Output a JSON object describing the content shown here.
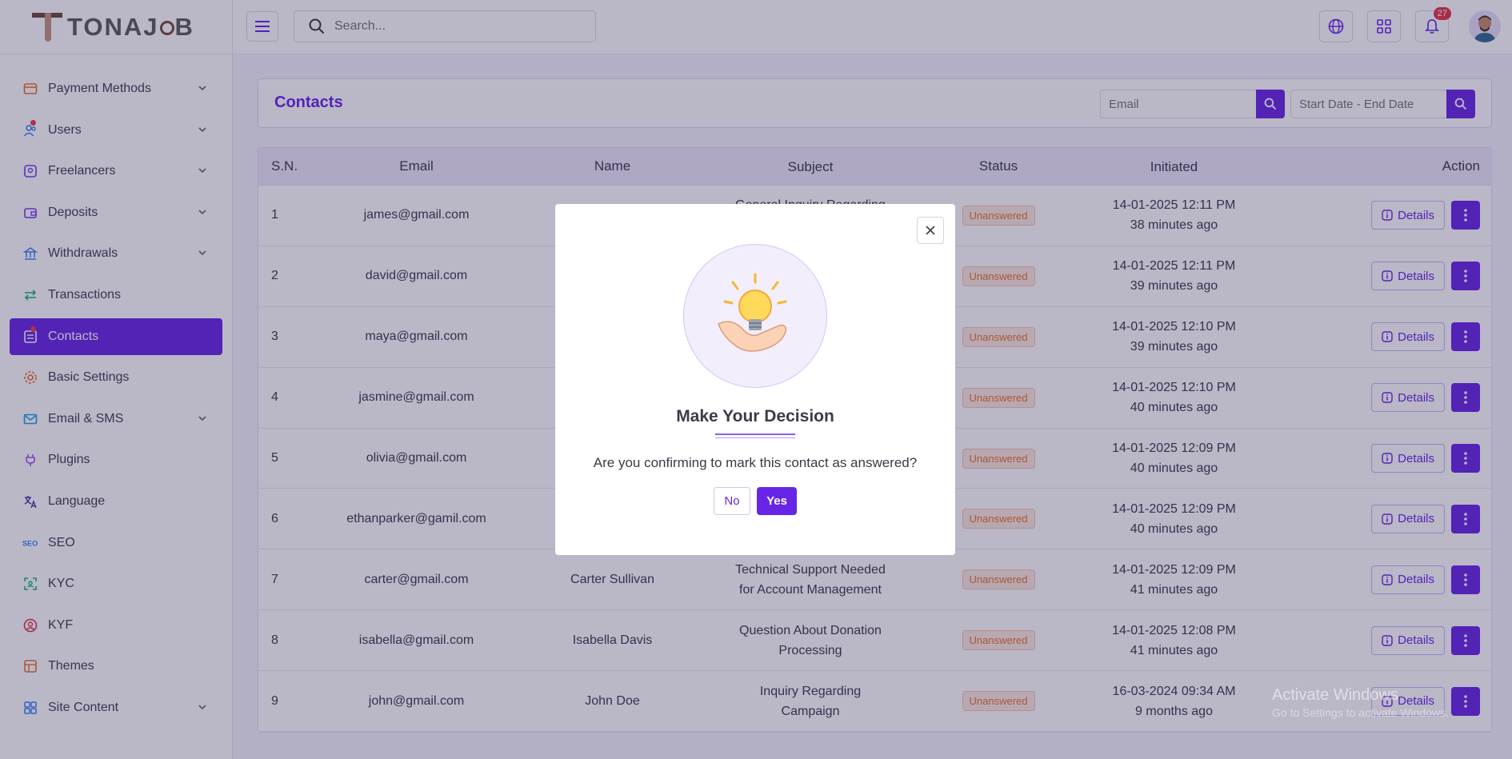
{
  "brand": {
    "logo_text": "TONAJ",
    "logo_text2": "B"
  },
  "header": {
    "search_placeholder": "Search...",
    "notifications_count": "27",
    "icons": [
      "menu-icon",
      "search-icon",
      "globe-icon",
      "apps-grid-icon",
      "bell-icon"
    ]
  },
  "sidebar": {
    "items": [
      {
        "label": "Payment Methods",
        "icon": "payment-icon",
        "has_chevron": true
      },
      {
        "label": "Users",
        "icon": "users-icon",
        "has_chevron": true,
        "dot": true
      },
      {
        "label": "Freelancers",
        "icon": "freelancer-icon",
        "has_chevron": true
      },
      {
        "label": "Deposits",
        "icon": "wallet-icon",
        "has_chevron": true
      },
      {
        "label": "Withdrawals",
        "icon": "bank-icon",
        "has_chevron": true
      },
      {
        "label": "Transactions",
        "icon": "transfer-icon",
        "has_chevron": false
      },
      {
        "label": "Contacts",
        "icon": "contacts-icon",
        "has_chevron": false,
        "active": true,
        "dot": true
      },
      {
        "label": "Basic Settings",
        "icon": "gear-icon",
        "has_chevron": false
      },
      {
        "label": "Email & SMS",
        "icon": "mail-icon",
        "has_chevron": true
      },
      {
        "label": "Plugins",
        "icon": "plug-icon",
        "has_chevron": false
      },
      {
        "label": "Language",
        "icon": "translate-icon",
        "has_chevron": false
      },
      {
        "label": "SEO",
        "icon": "seo-icon",
        "has_chevron": false
      },
      {
        "label": "KYC",
        "icon": "scan-face-icon",
        "has_chevron": false
      },
      {
        "label": "KYF",
        "icon": "user-badge-icon",
        "has_chevron": false
      },
      {
        "label": "Themes",
        "icon": "themes-icon",
        "has_chevron": false
      },
      {
        "label": "Site Content",
        "icon": "grid-icon",
        "has_chevron": true
      }
    ]
  },
  "page": {
    "title": "Contacts",
    "email_filter_placeholder": "Email",
    "date_filter_placeholder": "Start Date - End Date"
  },
  "table": {
    "columns": [
      "S.N.",
      "Email",
      "Name",
      "Subject",
      "Status",
      "Initiated",
      "Action"
    ],
    "details_label": "Details",
    "rows": [
      {
        "sn": "1",
        "email": "james@gmail.com",
        "name": "",
        "subject": "General Inquiry Regarding Platform",
        "status": "Unanswered",
        "date": "14-01-2025 12:11 PM",
        "ago": "38 minutes ago"
      },
      {
        "sn": "2",
        "email": "david@gmail.com",
        "name": "",
        "subject": "",
        "status": "Unanswered",
        "date": "14-01-2025 12:11 PM",
        "ago": "39 minutes ago"
      },
      {
        "sn": "3",
        "email": "maya@gmail.com",
        "name": "",
        "subject": "",
        "status": "Unanswered",
        "date": "14-01-2025 12:10 PM",
        "ago": "39 minutes ago"
      },
      {
        "sn": "4",
        "email": "jasmine@gmail.com",
        "name": "",
        "subject": "",
        "status": "Unanswered",
        "date": "14-01-2025 12:10 PM",
        "ago": "40 minutes ago"
      },
      {
        "sn": "5",
        "email": "olivia@gmail.com",
        "name": "",
        "subject": "",
        "status": "Unanswered",
        "date": "14-01-2025 12:09 PM",
        "ago": "40 minutes ago"
      },
      {
        "sn": "6",
        "email": "ethanparker@gamil.com",
        "name": "",
        "subject": "",
        "status": "Unanswered",
        "date": "14-01-2025 12:09 PM",
        "ago": "40 minutes ago"
      },
      {
        "sn": "7",
        "email": "carter@gmail.com",
        "name": "Carter Sullivan",
        "subject": "Technical Support Needed for Account Management",
        "status": "Unanswered",
        "date": "14-01-2025 12:09 PM",
        "ago": "41 minutes ago"
      },
      {
        "sn": "8",
        "email": "isabella@gmail.com",
        "name": "Isabella Davis",
        "subject": "Question About Donation Processing",
        "status": "Unanswered",
        "date": "14-01-2025 12:08 PM",
        "ago": "41 minutes ago"
      },
      {
        "sn": "9",
        "email": "john@gmail.com",
        "name": "John Doe",
        "subject": "Inquiry Regarding Campaign",
        "status": "Unanswered",
        "date": "16-03-2024 09:34 AM",
        "ago": "9 months ago"
      }
    ]
  },
  "modal": {
    "title": "Make Your Decision",
    "message": "Are you confirming to mark this contact as answered?",
    "no_label": "No",
    "yes_label": "Yes"
  },
  "watermark": {
    "line1": "Activate Windows",
    "line2": "Go to Settings to activate Windows."
  },
  "colors": {
    "accent": "#6726e6",
    "status": "#e8742a",
    "badge": "#e23547"
  }
}
